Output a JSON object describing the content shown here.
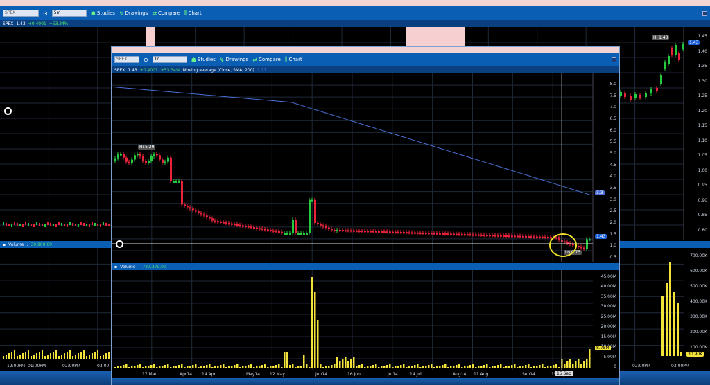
{
  "back": {
    "symbol_input": "SPEX",
    "interval": "5m",
    "toolbar": {
      "studies": "Studies",
      "drawings": "Drawings",
      "compare": "Compare",
      "chart": "Chart"
    },
    "quote": {
      "symbol": "SPEX",
      "price": "1.43",
      "change": "+0.4001",
      "pct": "+53.34%"
    },
    "y_ticks": [
      "1.45",
      "1.40",
      "1.35",
      "1.30",
      "1.25",
      "1.20",
      "1.15",
      "1.10",
      "1.05",
      "1.00",
      "0.95",
      "0.90",
      "0.85",
      "0.80"
    ],
    "price_tag": "1.43",
    "hi_label": "Hi 1.43",
    "volume_label": "Volume",
    "volume_value": "30,900.00",
    "vol_ticks": [
      "700.00K",
      "600.00K",
      "500.00K",
      "400.00K",
      "300.00K",
      "200.00K",
      "100.00K"
    ],
    "vol_tag": "30.90K",
    "x_ticks": [
      "12:00PM",
      "01:00PM",
      "02:00PM",
      "03:00",
      "02:00PM",
      "03:00PM"
    ]
  },
  "front": {
    "symbol_input": "SPEX",
    "interval": "1d",
    "toolbar": {
      "studies": "Studies",
      "drawings": "Drawings",
      "compare": "Compare",
      "chart": "Chart"
    },
    "quote": {
      "symbol": "SPEX",
      "price": "1.43",
      "change": "+0.4001",
      "pct": "+53.34%",
      "ma": "Moving average (Close, SMA, 200)",
      "ma_value": "3.27"
    },
    "y_ticks": [
      "8.0",
      "7.5",
      "7.0",
      "6.5",
      "6.0",
      "5.5",
      "5.0",
      "4.5",
      "4.0",
      "3.5",
      "3.0",
      "2.5",
      "2.0",
      "1.5",
      "1.0",
      "0.5"
    ],
    "ma_tag": "3.3",
    "price_tag": "1.43",
    "hi_label": "Hi 5.29",
    "lo_label": "Lo 0.75",
    "volume_label": "Volume",
    "volume_value": "727,379.00",
    "vol_ticks": [
      "45.00M",
      "40.00M",
      "35.00M",
      "30.00M",
      "25.00M",
      "20.00M",
      "15.00M",
      "10.00M",
      "5.00M",
      "0"
    ],
    "vol_tag": "8.78M",
    "x_ticks": [
      "17 Mar",
      "Apr14",
      "14 Apr",
      "May14",
      "12 May",
      "Jun14",
      "16 Jun",
      "Jul14",
      "14 Jul",
      "Aug14",
      "11 Aug",
      "Sep14",
      "15 Sep"
    ],
    "cursor_label": "15 Sep"
  },
  "colors": {
    "up": "#27c93f",
    "down": "#e8233a",
    "ma": "#4a6fd6",
    "volume": "#f2e23a",
    "toolbar": "#0a5fb4",
    "highlight": "#f0e32a"
  }
}
